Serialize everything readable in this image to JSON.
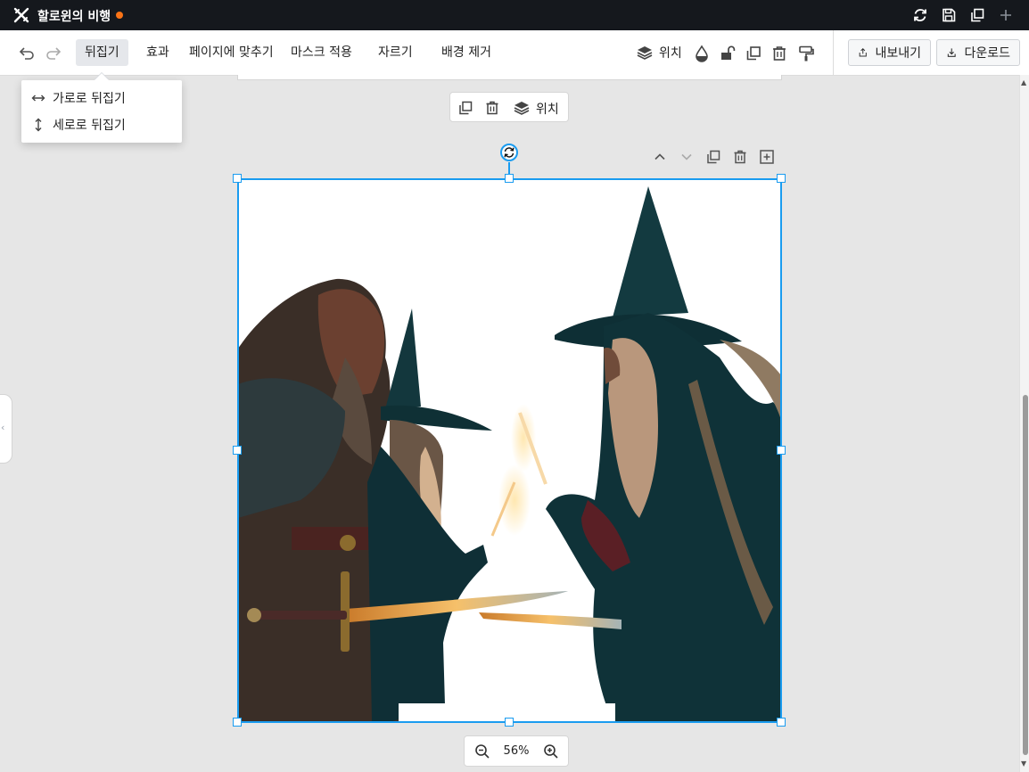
{
  "app": {
    "title": "할로윈의 비행",
    "unsaved_color": "#f97316"
  },
  "titlebar_icons": [
    "refresh-icon",
    "save-icon",
    "duplicate-icon",
    "plus-icon"
  ],
  "toolbar": {
    "undo_icon": "undo-icon",
    "redo_icon": "redo-icon",
    "flip_label": "뒤집기",
    "effect_label": "효과",
    "fit_page_label": "페이지에 맞추기",
    "mask_label": "마스크 적용",
    "crop_label": "자르기",
    "remove_bg_label": "배경 제거",
    "position_label": "위치",
    "export_label": "내보내기",
    "download_label": "다운로드"
  },
  "flip_menu": {
    "horizontal": "가로로 뒤집기",
    "vertical": "세로로 뒤집기"
  },
  "page_toolbar": {
    "position_label": "위치"
  },
  "zoom": {
    "value": "56%"
  },
  "colors": {
    "selection": "#1a9cf0",
    "titlebar_bg": "#15181d"
  }
}
